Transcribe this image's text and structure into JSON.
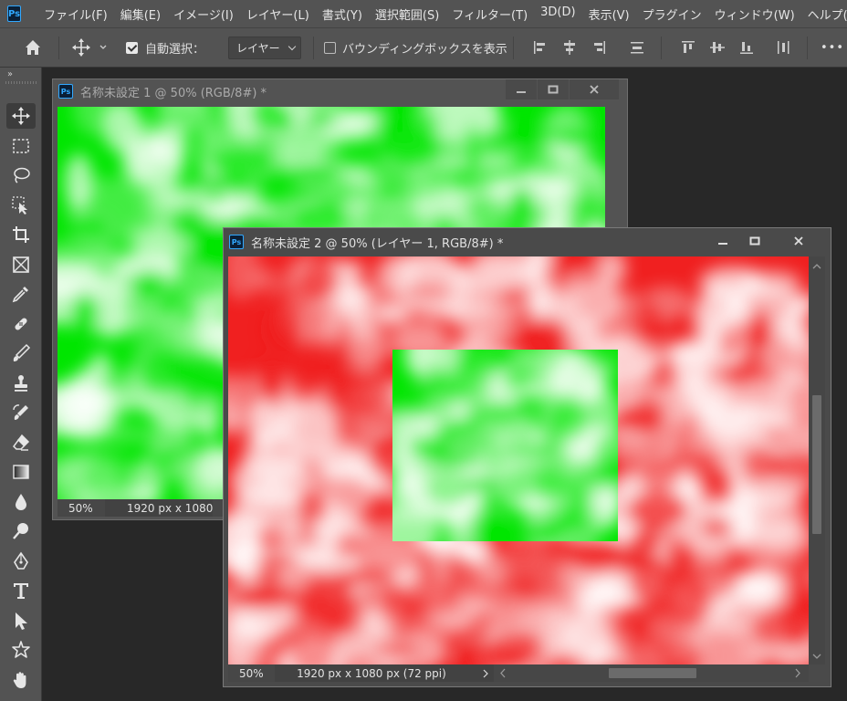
{
  "app": {
    "logo": "Ps"
  },
  "menu": [
    "ファイル(F)",
    "編集(E)",
    "イメージ(I)",
    "レイヤー(L)",
    "書式(Y)",
    "選択範囲(S)",
    "フィルター(T)",
    "3D(D)",
    "表示(V)",
    "プラグイン",
    "ウィンドウ(W)",
    "ヘルプ(H)"
  ],
  "options": {
    "auto_select_label": "自動選択：",
    "auto_select_checked": true,
    "target": "レイヤー",
    "bounding_box_label": "バウンディングボックスを表示",
    "bounding_box_checked": false,
    "more": "•••"
  },
  "tools": [
    "move-icon",
    "rect-marquee-icon",
    "lasso-icon",
    "object-select-icon",
    "crop-icon",
    "frame-icon",
    "eyedropper-icon",
    "healing-brush-icon",
    "brush-icon",
    "stamp-icon",
    "history-brush-icon",
    "eraser-icon",
    "gradient-icon",
    "blur-icon",
    "dodge-icon",
    "pen-icon",
    "type-icon",
    "path-select-icon",
    "shape-icon",
    "hand-icon"
  ],
  "toolbar_collapse": "››",
  "doc1": {
    "title": "名称未設定 1 @ 50% (RGB/8#) *",
    "zoom": "50%",
    "dims": "1920 px x 1080",
    "color": "#00e600"
  },
  "doc2": {
    "title": "名称未設定 2 @ 50% (レイヤー 1, RGB/8#) *",
    "zoom": "50%",
    "dims": "1920 px x 1080 px (72 ppi)",
    "color": "#f02020",
    "inner_color": "#00e600"
  },
  "window_controls": {
    "minimize": "minimize-icon",
    "restore": "restore-icon",
    "close": "close-icon"
  }
}
